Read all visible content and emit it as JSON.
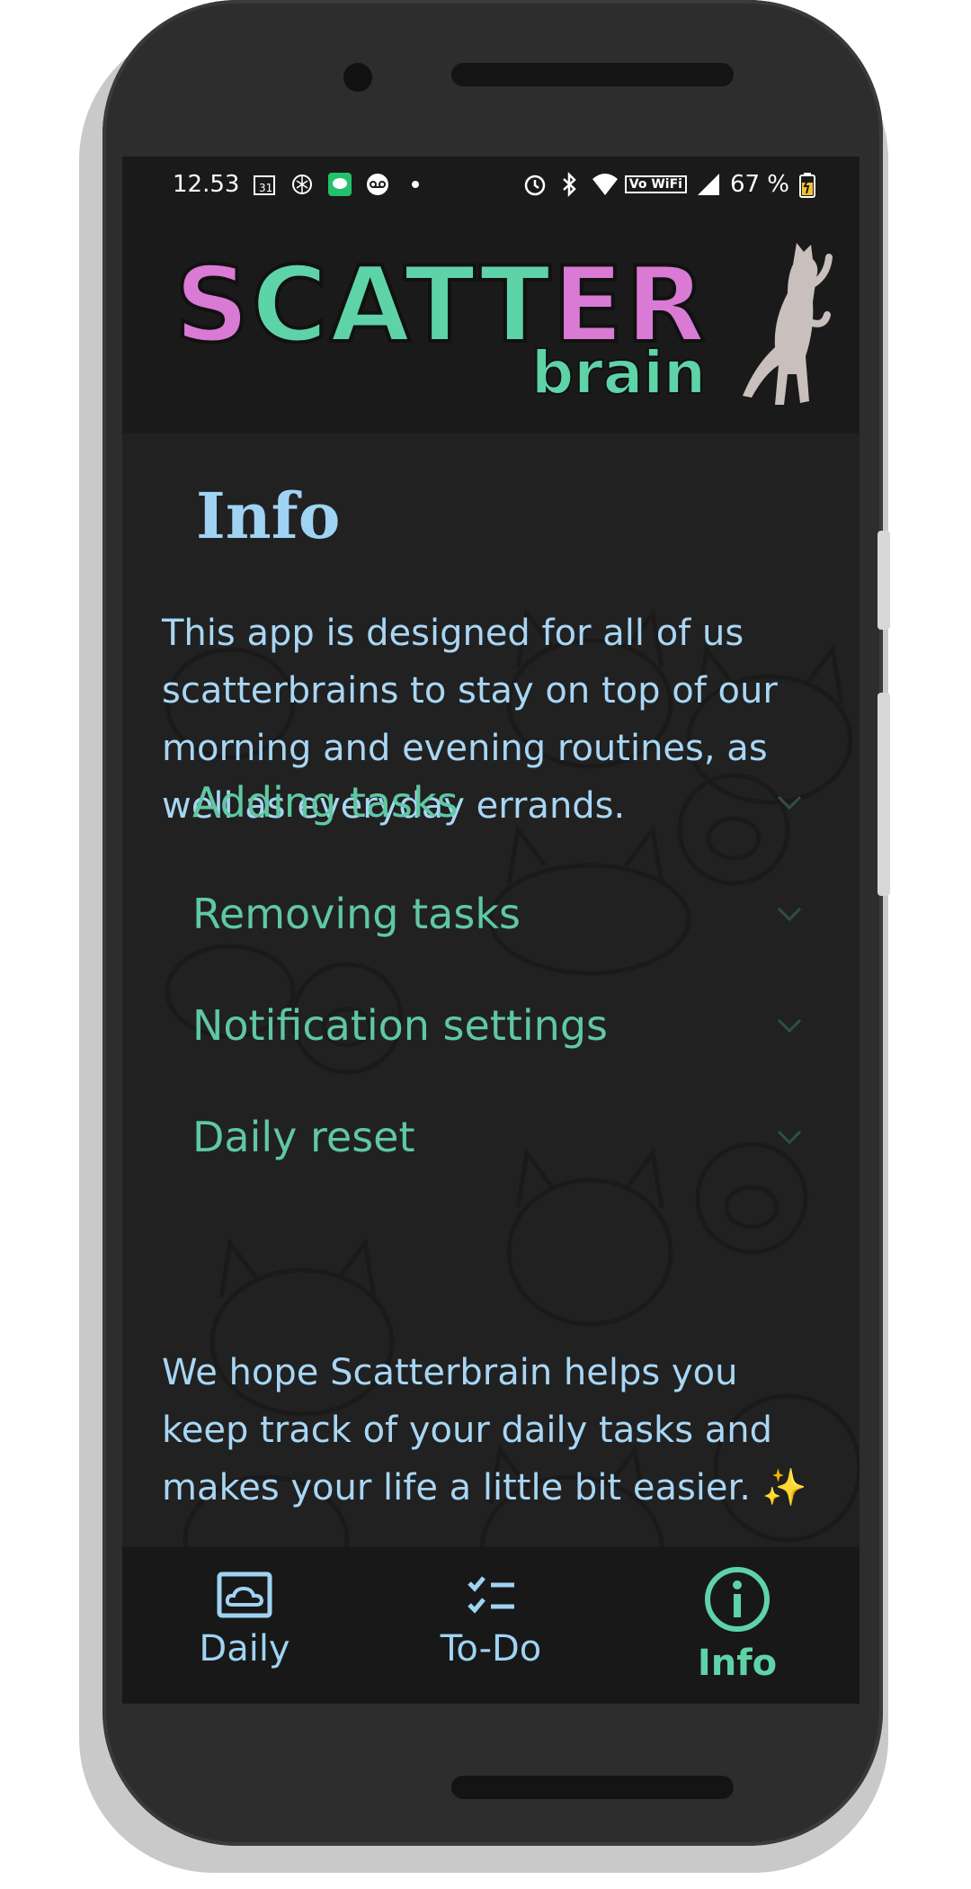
{
  "status_bar": {
    "time": "12.53",
    "calendar_day": "31",
    "battery": "67 %",
    "wifi_label": "Vo WiFi"
  },
  "header": {
    "logo_word": "SCATTER",
    "logo_sub": "brain"
  },
  "page": {
    "title": "Info",
    "intro": "This app is designed for all of us scatterbrains to stay on top of our morning and evening routines, as well as everyday errands.",
    "sections": [
      {
        "label": "Adding tasks"
      },
      {
        "label": "Removing tasks"
      },
      {
        "label": "Notification settings"
      },
      {
        "label": "Daily reset"
      }
    ],
    "outro": "We hope Scatterbrain helps you keep track of your daily tasks and makes your life a little bit easier. ✨"
  },
  "nav": {
    "items": [
      {
        "label": "Daily",
        "icon": "cloud-photo-icon"
      },
      {
        "label": "To-Do",
        "icon": "checklist-icon"
      },
      {
        "label": "Info",
        "icon": "info-icon",
        "active": true
      }
    ]
  },
  "colors": {
    "accent_teal": "#5fd3a8",
    "accent_pink": "#d97ad4",
    "text_blue": "#a8d6f4"
  }
}
